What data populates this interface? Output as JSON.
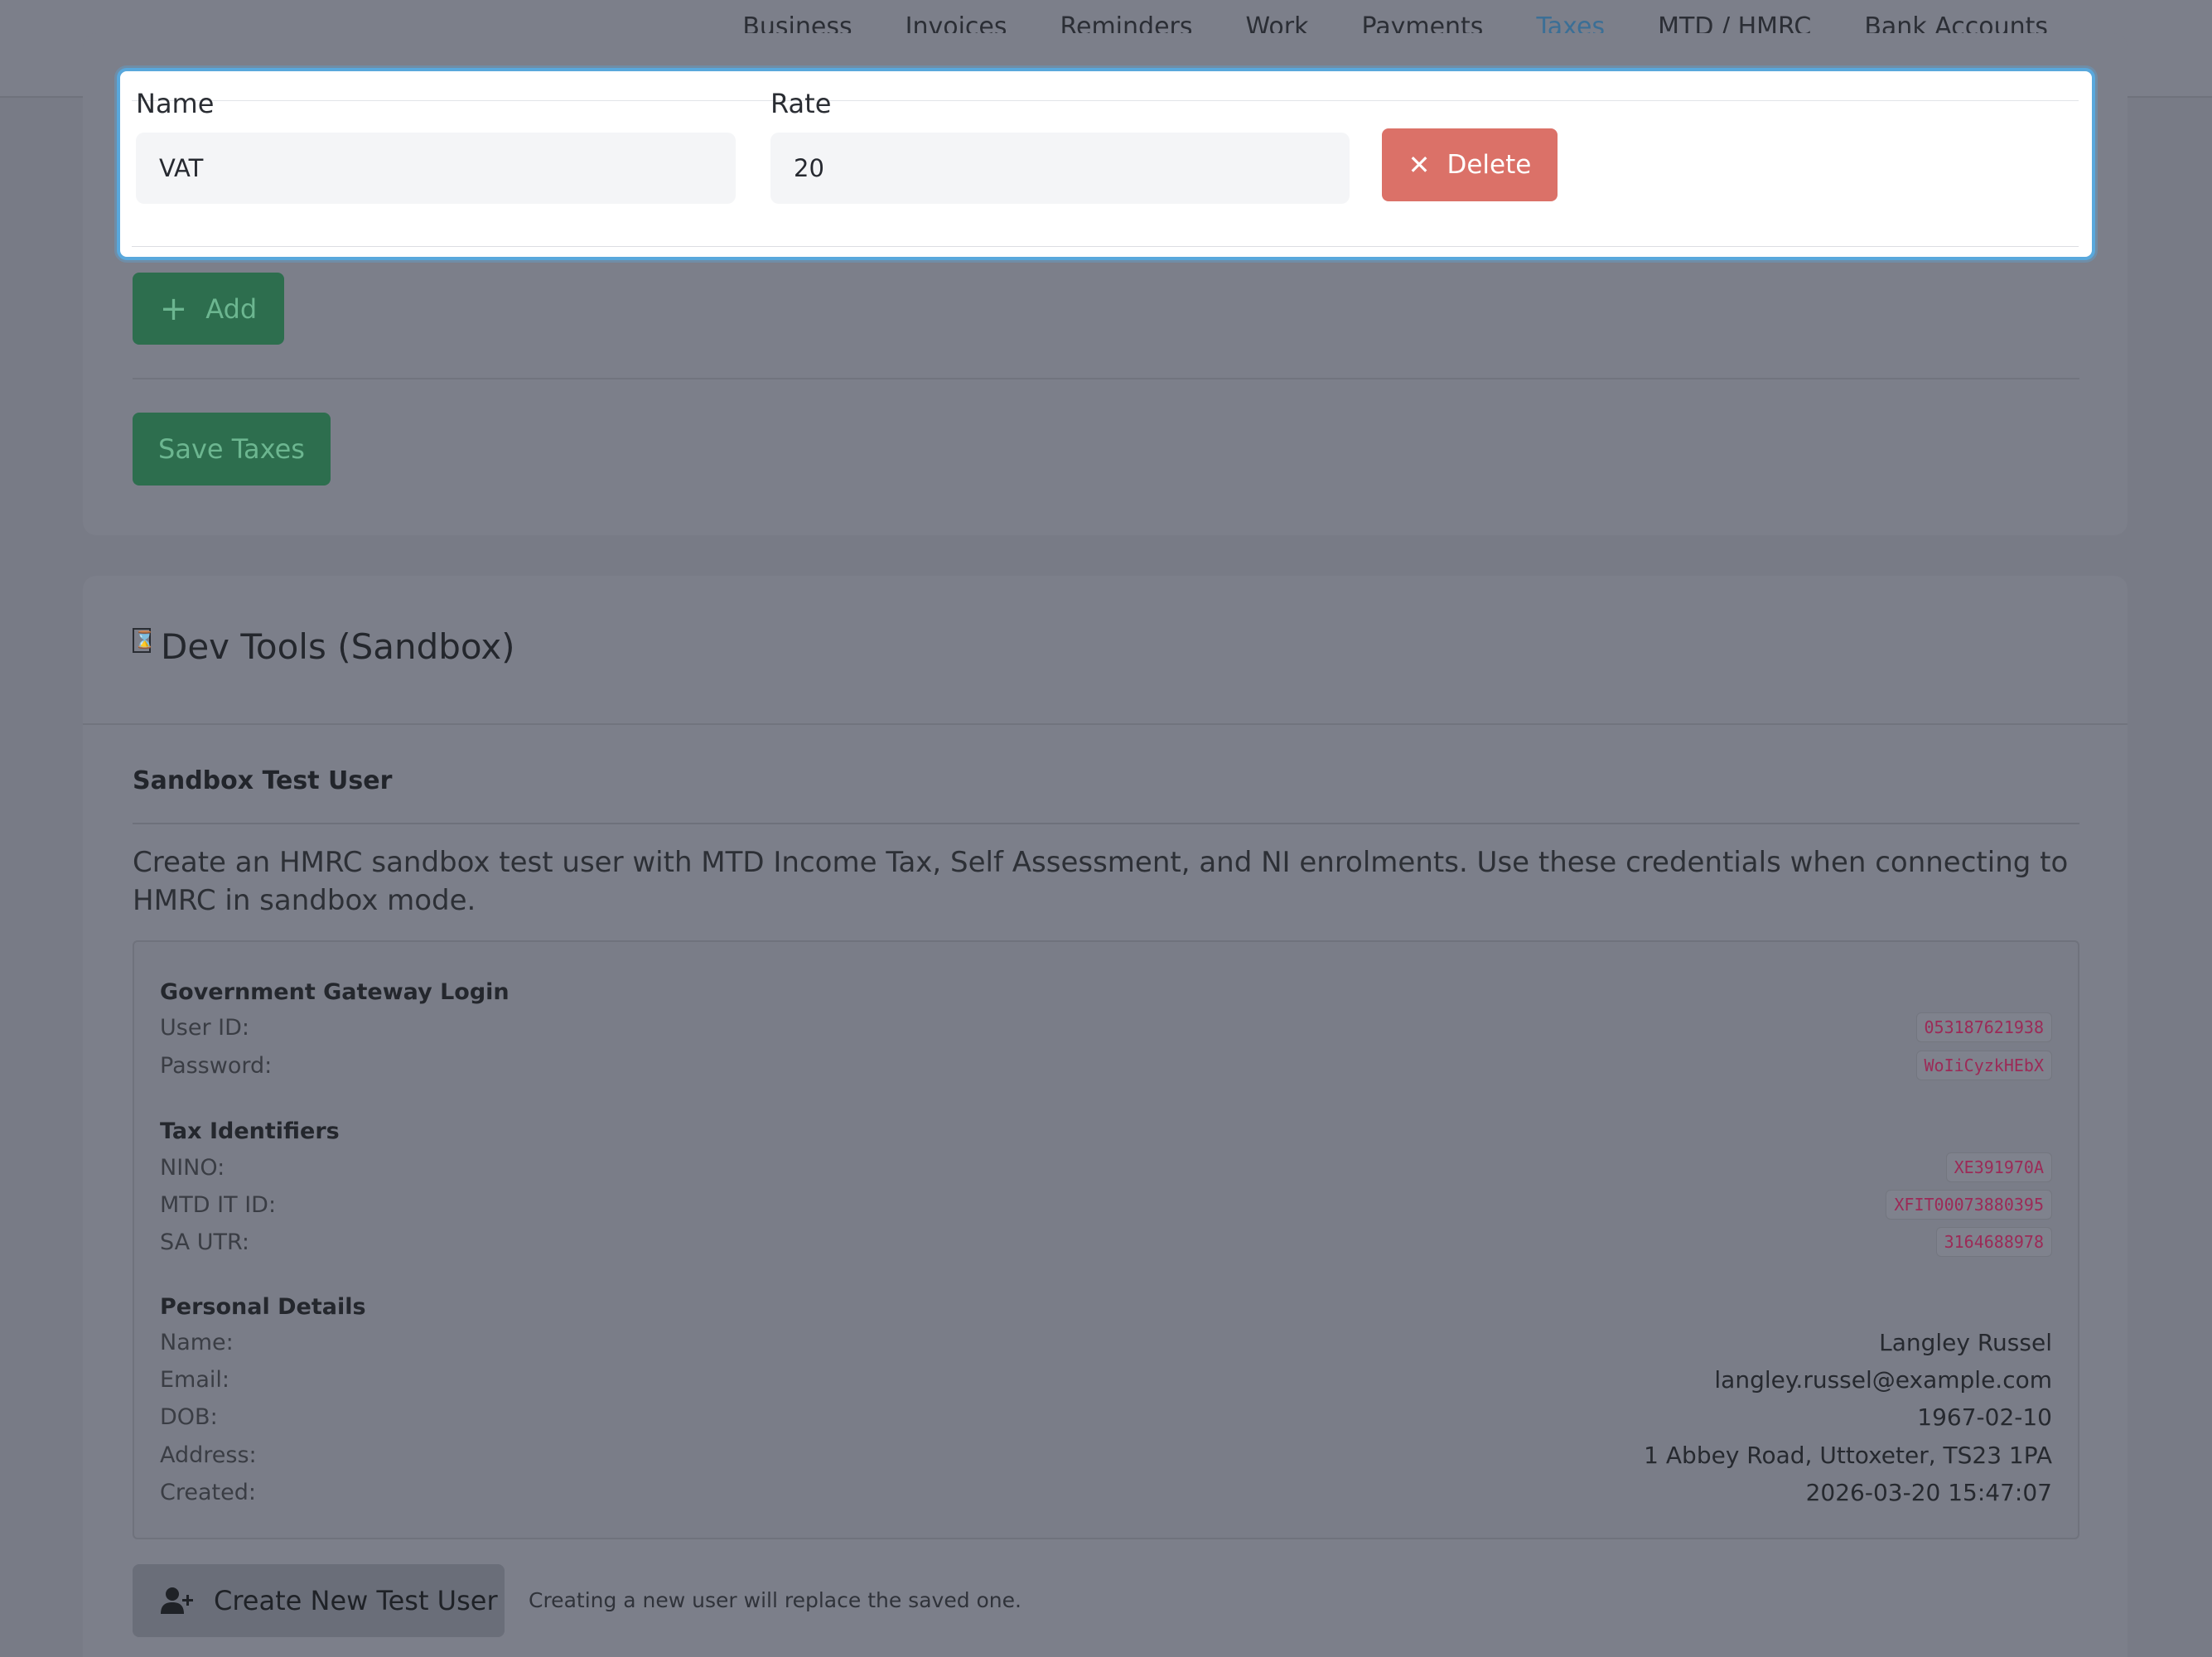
{
  "nav": {
    "items": [
      {
        "label": "Business"
      },
      {
        "label": "Invoices"
      },
      {
        "label": "Reminders"
      },
      {
        "label": "Work"
      },
      {
        "label": "Payments"
      },
      {
        "label": "Taxes",
        "active": true
      },
      {
        "label": "MTD / HMRC"
      },
      {
        "label": "Bank Accounts"
      }
    ]
  },
  "taxes": {
    "add_label": "Add",
    "save_label": "Save Taxes"
  },
  "modal": {
    "name_label": "Name",
    "rate_label": "Rate",
    "name_value": "VAT",
    "rate_value": "20",
    "delete_label": "Delete"
  },
  "dev": {
    "title": "Dev Tools (Sandbox)",
    "sandbox_heading": "Sandbox Test User",
    "description": "Create an HMRC sandbox test user with MTD Income Tax, Self Assessment, and NI enrolments. Use these credentials when connecting to HMRC in sandbox mode.",
    "gateway": {
      "heading": "Government Gateway Login",
      "user_id_label": "User ID:",
      "user_id": "053187621938",
      "password_label": "Password:",
      "password": "WoIiCyzkHEbX"
    },
    "tax_ids": {
      "heading": "Tax Identifiers",
      "nino_label": "NINO:",
      "nino": "XE391970A",
      "mtd_label": "MTD IT ID:",
      "mtd": "XFIT00073880395",
      "utr_label": "SA UTR:",
      "utr": "3164688978"
    },
    "personal": {
      "heading": "Personal Details",
      "name_label": "Name:",
      "name": "Langley Russel",
      "email_label": "Email:",
      "email": "langley.russel@example.com",
      "dob_label": "DOB:",
      "dob": "1967-02-10",
      "address_label": "Address:",
      "address": "1 Abbey Road, Uttoxeter, TS23 1PA",
      "created_label": "Created:",
      "created": "2026-03-20 15:47:07"
    },
    "create_label": "Create New Test User",
    "create_note": "Creating a new user will replace the saved one."
  }
}
